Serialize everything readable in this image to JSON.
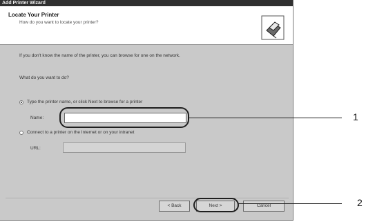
{
  "window": {
    "title": "Add Printer Wizard"
  },
  "header": {
    "title": "Locate Your Printer",
    "subtitle": "How do you want to locate your printer?",
    "icon": "printer-icon"
  },
  "body": {
    "intro": "If you don't know the name of the printer, you can browse for one on the network.",
    "question": "What do you want to do?",
    "option_type_name": "Type the printer name, or click Next to browse for a printer",
    "name_label": "Name:",
    "name_value": "",
    "option_connect": "Connect to a printer on the Internet or on your intranet",
    "url_label": "URL:",
    "url_value": ""
  },
  "buttons": {
    "back": "< Back",
    "next": "Next >",
    "cancel": "Cancel"
  },
  "callouts": [
    "1",
    "2"
  ]
}
